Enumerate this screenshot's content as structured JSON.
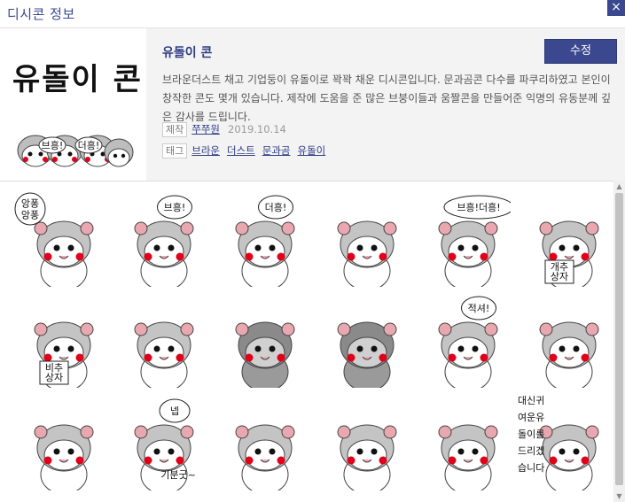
{
  "window": {
    "title": "디시콘 정보",
    "close_label": "×"
  },
  "con": {
    "thumb_title": "유돌이 콘",
    "thumb_bubbles": [
      "브흥!",
      "더흥!"
    ],
    "name": "유돌이 콘",
    "edit_label": "수정",
    "description": "브라운더스트 채고 기업둥이 유돌이로 꽉꽉 채운 디시콘입니다. 문과곰콘 다수를 파쿠리하였고 본인이 창작한 콘도 몇개 있습니다. 제작에 도움을 준 많은 브붕이들과 움짤콘을 만들어준 익명의 유동분께 깊은 감사를 드립니다.",
    "maker_label": "제작",
    "maker": "쭈쭈원",
    "date": "2019.10.14",
    "tag_label": "태그",
    "tags": [
      "브라운",
      "더스트",
      "문과곰",
      "유돌이"
    ]
  },
  "stickers": [
    {
      "bubble": [
        "앙퐁",
        "앙퐁"
      ]
    },
    {
      "bubble": [
        "브흥!"
      ]
    },
    {
      "bubble": [
        "더흥!"
      ]
    },
    {
      "bubble": []
    },
    {
      "bubble": [
        "브흥!더흥!"
      ]
    },
    {
      "bubble": [],
      "box": [
        "개추",
        "상자"
      ]
    },
    {
      "bubble": [],
      "box": [
        "비추",
        "상자"
      ]
    },
    {
      "bubble": []
    },
    {
      "bubble": []
    },
    {
      "bubble": []
    },
    {
      "bubble": [
        "적셔!"
      ]
    },
    {
      "bubble": []
    },
    {
      "bubble": []
    },
    {
      "bubble": [
        "넵"
      ],
      "caption": "기분굿~"
    },
    {
      "bubble": []
    },
    {
      "bubble": []
    },
    {
      "bubble": []
    },
    {
      "bubble": [],
      "text_lines": [
        "대신귀",
        "여운유",
        "돌이를",
        "드리겠",
        "습니다"
      ]
    }
  ],
  "colors": {
    "accent": "#3b4890",
    "link": "#2f3c85",
    "panel": "#f3f3f3"
  }
}
